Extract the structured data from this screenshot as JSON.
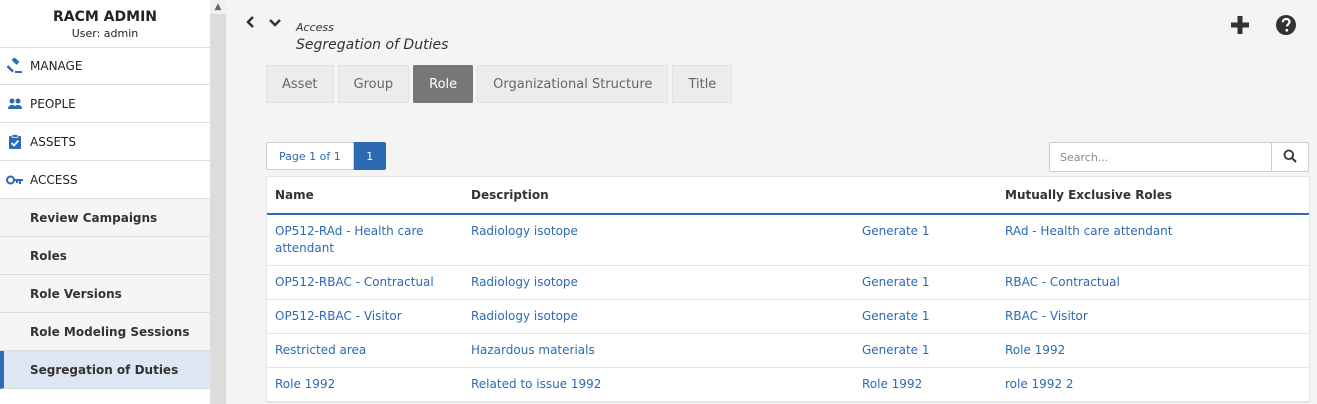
{
  "app": {
    "title": "RACM ADMIN",
    "user": "User: admin"
  },
  "sidebar": {
    "main_items": [
      {
        "label": "MANAGE",
        "icon": "gavel-icon"
      },
      {
        "label": "PEOPLE",
        "icon": "people-icon"
      },
      {
        "label": "ASSETS",
        "icon": "clipboard-check-icon"
      },
      {
        "label": "ACCESS",
        "icon": "key-icon"
      }
    ],
    "sub_items": [
      {
        "label": "Review Campaigns"
      },
      {
        "label": "Roles"
      },
      {
        "label": "Role Versions"
      },
      {
        "label": "Role Modeling Sessions"
      },
      {
        "label": "Segregation of Duties",
        "active": true
      }
    ]
  },
  "header": {
    "breadcrumb": "Access",
    "title": "Segregation of Duties"
  },
  "tabs": [
    {
      "label": "Asset"
    },
    {
      "label": "Group"
    },
    {
      "label": "Role",
      "active": true
    },
    {
      "label": "Organizational Structure"
    },
    {
      "label": "Title"
    }
  ],
  "pager": {
    "label": "Page 1 of 1",
    "current": "1"
  },
  "search": {
    "placeholder": "Search..."
  },
  "table": {
    "columns": [
      "Name",
      "Description",
      "",
      "Mutually Exclusive Roles"
    ],
    "rows": [
      {
        "name": "OP512-RAd - Health care attendant",
        "description": "Radiology isotope",
        "extra": "Generate 1",
        "exclusive": "RAd - Health care attendant"
      },
      {
        "name": "OP512-RBAC - Contractual",
        "description": "Radiology isotope",
        "extra": "Generate 1",
        "exclusive": "RBAC - Contractual"
      },
      {
        "name": "OP512-RBAC - Visitor",
        "description": "Radiology isotope",
        "extra": "Generate 1",
        "exclusive": "RBAC - Visitor"
      },
      {
        "name": "Restricted area",
        "description": "Hazardous materials",
        "extra": "Generate 1",
        "exclusive": "Role 1992"
      },
      {
        "name": "Role 1992",
        "description": "Related to issue 1992",
        "extra": "Role 1992",
        "exclusive": "role 1992 2"
      }
    ]
  },
  "colors": {
    "accent": "#2d6ab4",
    "active_tab": "#777777"
  }
}
